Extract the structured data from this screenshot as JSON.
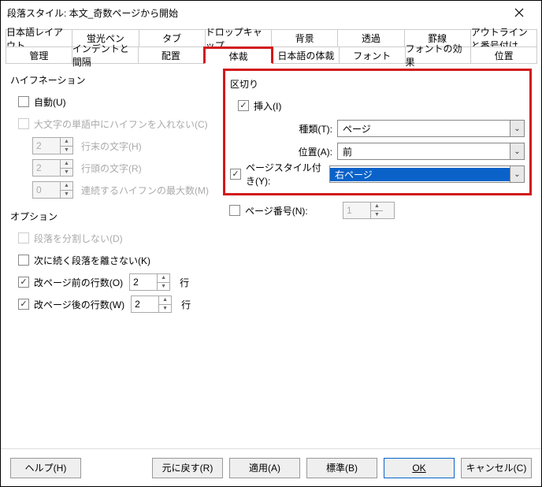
{
  "titlebar": {
    "title": "段落スタイル: 本文_奇数ページから開始"
  },
  "tabs_row1": [
    "日本語レイアウト",
    "蛍光ペン",
    "タブ",
    "ドロップキャップ",
    "背景",
    "透過",
    "罫線",
    "アウトラインと番号付け"
  ],
  "tabs_row2": [
    "管理",
    "インデントと間隔",
    "配置",
    "体裁",
    "日本語の体裁",
    "フォント",
    "フォントの効果",
    "位置"
  ],
  "active_tab": "体裁",
  "hyphen": {
    "title": "ハイフネーション",
    "auto": "自動(U)",
    "no_caps": "大文字の単語中にハイフンを入れない(C)",
    "end_val": "2",
    "end_lbl": "行末の文字(H)",
    "begin_val": "2",
    "begin_lbl": "行頭の文字(R)",
    "max_val": "0",
    "max_lbl": "連続するハイフンの最大数(M)"
  },
  "options": {
    "title": "オプション",
    "nosplit": "段落を分割しない(D)",
    "keepnext": "次に続く段落を離さない(K)",
    "orphan_lbl": "改ページ前の行数(O)",
    "orphan_val": "2",
    "orphan_unit": "行",
    "widow_lbl": "改ページ後の行数(W)",
    "widow_val": "2",
    "widow_unit": "行"
  },
  "breaks": {
    "title": "区切り",
    "insert": "挿入(I)",
    "type_lbl": "種類(T):",
    "type_val": "ページ",
    "pos_lbl": "位置(A):",
    "pos_val": "前",
    "style_lbl": "ページスタイル付き(Y):",
    "style_val": "右ページ",
    "pageno_lbl": "ページ番号(N):",
    "pageno_val": "1"
  },
  "footer": {
    "help": "ヘルプ(H)",
    "reset": "元に戻す(R)",
    "apply": "適用(A)",
    "standard": "標準(B)",
    "ok": "OK",
    "cancel": "キャンセル(C)"
  }
}
